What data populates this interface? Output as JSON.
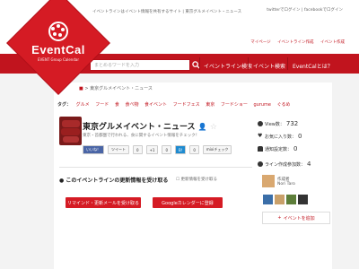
{
  "header": {
    "tagline": "イベントラインはイベント情報を共有するサイト",
    "subline": "東京グルメイベント・ニュース",
    "top_links": [
      "twitterでログイン",
      "facebookでログイン"
    ],
    "sub_links": [
      "マイページ",
      "イベントライン作成",
      "イベント作成"
    ]
  },
  "logo": {
    "name": "EventCal",
    "sub": "EVENT Group Calendar"
  },
  "search": {
    "placeholder": "まとめるワードを入力"
  },
  "nav": {
    "items": [
      "イベントライン検索",
      "イベント検索",
      "EventCalとは？"
    ]
  },
  "breadcrumb": "東京グルメイベント・ニュース",
  "tags": {
    "label": "タグ：",
    "items": [
      "グルメ",
      "フード",
      "食",
      "食べ物",
      "食イベント",
      "フードフェス",
      "東京",
      "フードショー",
      "gurume",
      "ぐるめ"
    ]
  },
  "event": {
    "title": "東京グルメイベント・ニュース",
    "description": "東京・首都圏で行われる、食に関するイベント情報をチェック！",
    "social": [
      "いいね！",
      "ツイート",
      "0",
      "+1",
      "0",
      "B!",
      "0",
      "mixiチェック"
    ]
  },
  "update": {
    "title": "このイベントラインの更新情報を受け取る",
    "register_link": "更新情報を受け取る",
    "buttons": [
      "リマインド・更新メールを受け取る",
      "Googleカレンダーに登録"
    ]
  },
  "stats": {
    "views_label": "View数：",
    "views": "732",
    "fav_label": "お気に入り数：",
    "fav": "0",
    "notify_label": "通知設定数：",
    "notify": "0",
    "line_count_label": "ライン作成参加数：",
    "line_count": "4"
  },
  "creator": {
    "label": "作成者",
    "name": "Nori Taro"
  },
  "add_event_label": "イベントを追加"
}
